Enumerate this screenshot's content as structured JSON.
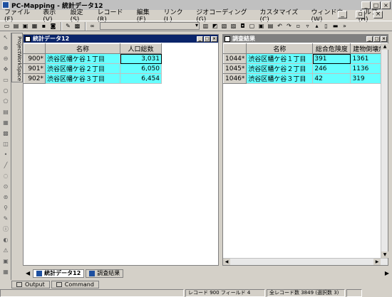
{
  "window": {
    "title": "PC-Mapping - 統計データ12"
  },
  "menu": [
    "ファイル(F)",
    "表示(V)",
    "設定(S)",
    "レコード(R)",
    "編集(E)",
    "リンク(L)",
    "ジオコーディング(G)",
    "カスタマイズ(C)",
    "ウィンドウ(W)",
    "ヘルプ(H)"
  ],
  "side_tab": "ProjectWorkSpace",
  "left_pane": {
    "title": "統計データ12",
    "columns": [
      "名称",
      "人口総数"
    ],
    "rows": [
      {
        "id": "900*",
        "name": "渋谷区幡ケ谷１丁目",
        "value": "3,031"
      },
      {
        "id": "901*",
        "name": "渋谷区幡ケ谷２丁目",
        "value": "6,050"
      },
      {
        "id": "902*",
        "name": "渋谷区幡ケ谷３丁目",
        "value": "6,454"
      }
    ]
  },
  "right_pane": {
    "title": "調査結果",
    "columns": [
      "名称",
      "総合危険度",
      "建物倒壊危"
    ],
    "rows": [
      {
        "id": "1044*",
        "name": "渋谷区幡ケ谷１丁目",
        "v1": "391",
        "v2": "1361"
      },
      {
        "id": "1045*",
        "name": "渋谷区幡ケ谷２丁目",
        "v1": "246",
        "v2": "1136"
      },
      {
        "id": "1046*",
        "name": "渋谷区幡ケ谷３丁目",
        "v1": "42",
        "v2": "319"
      }
    ]
  },
  "doc_tabs": [
    "統計データ12",
    "調査結果"
  ],
  "output_tabs": [
    "Output",
    "Command"
  ],
  "status": {
    "record": "レコード  900  フィールド  4",
    "total": "全レコード数  3849 (選択数  3)"
  },
  "colors": {
    "active_title": "#0a246a",
    "inactive_title": "#808080",
    "selection": "#66ffff"
  }
}
